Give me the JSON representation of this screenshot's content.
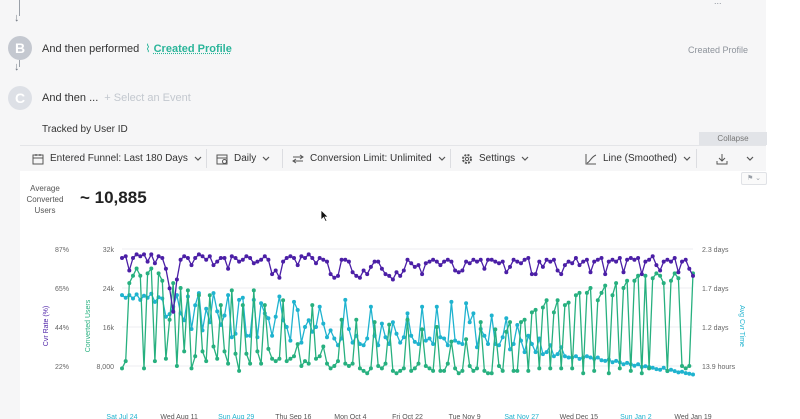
{
  "funnel": {
    "steps": [
      {
        "letter": "B",
        "prefix": "And then performed",
        "event": "Created Profile",
        "right_label": "Created Profile"
      },
      {
        "letter": "C",
        "prefix": "And then ...",
        "add_event": "Select an Event"
      }
    ],
    "tracked_by": "Tracked by User ID",
    "collapse_label": "Collapse",
    "top_right_partial": "..."
  },
  "toolbar": {
    "entered_funnel": "Entered Funnel: Last 180 Days",
    "interval": "Daily",
    "conversion_limit": "Conversion Limit: Unlimited",
    "settings": "Settings",
    "chart_type": "Line (Smoothed)"
  },
  "summary": {
    "label": "Average Converted Users",
    "value": "~ 10,885"
  },
  "chart_data": {
    "type": "line",
    "left_axis_label": "Cvr Rate (%)",
    "middle_axis_label": "Converted Users",
    "right_axis_label": "Avg Cvr Time",
    "left_ticks": [
      "87%",
      "65%",
      "44%",
      "22%"
    ],
    "middle_ticks": [
      "32k",
      "24k",
      "16k",
      "8,000"
    ],
    "right_ticks": [
      "2.3 days",
      "1.7 days",
      "1.2 days",
      "13.9 hours"
    ],
    "x_ticks": [
      {
        "label": "Sat Jul 24",
        "highlight": true
      },
      {
        "label": "Wed Aug 11",
        "highlight": false
      },
      {
        "label": "Sun Aug 29",
        "highlight": true
      },
      {
        "label": "Thu Sep 16",
        "highlight": false
      },
      {
        "label": "Mon Oct 4",
        "highlight": false
      },
      {
        "label": "Fri Oct 22",
        "highlight": false
      },
      {
        "label": "Tue Nov 9",
        "highlight": false
      },
      {
        "label": "Sat Nov 27",
        "highlight": true
      },
      {
        "label": "Wed Dec 15",
        "highlight": false
      },
      {
        "label": "Sun Jan 2",
        "highlight": true
      },
      {
        "label": "Wed Jan 19",
        "highlight": false
      }
    ],
    "conversion_rate_pct": [
      82,
      83,
      75,
      82,
      84,
      83,
      84,
      80,
      84,
      79,
      83,
      82,
      76,
      65,
      52,
      70,
      81,
      83,
      82,
      78,
      82,
      84,
      83,
      81,
      83,
      78,
      80,
      82,
      82,
      76,
      83,
      82,
      80,
      81,
      83,
      82,
      79,
      80,
      81,
      83,
      81,
      73,
      75,
      71,
      80,
      82,
      83,
      82,
      78,
      83,
      82,
      84,
      82,
      79,
      82,
      81,
      80,
      73,
      71,
      72,
      81,
      81,
      80,
      74,
      72,
      71,
      75,
      73,
      77,
      80,
      80,
      76,
      73,
      72,
      70,
      74,
      72,
      75,
      81,
      79,
      77,
      78,
      73,
      79,
      80,
      81,
      80,
      78,
      80,
      81,
      80,
      75,
      74,
      75,
      80,
      79,
      81,
      80,
      81,
      76,
      81,
      81,
      80,
      79,
      80,
      74,
      77,
      81,
      80,
      79,
      81,
      82,
      73,
      73,
      80,
      77,
      81,
      80,
      81,
      75,
      73,
      78,
      80,
      79,
      82,
      78,
      80,
      81,
      74,
      80,
      81,
      82,
      73,
      80,
      81,
      80,
      82,
      74,
      81,
      82,
      81,
      82,
      73,
      80,
      81,
      83,
      78,
      75,
      80,
      81,
      80,
      82,
      74,
      80,
      81,
      76,
      72
    ],
    "converted_users": [
      7500,
      9000,
      25000,
      26500,
      28000,
      26500,
      7500,
      27000,
      28000,
      9000,
      27000,
      25500,
      9500,
      17500,
      25000,
      8000,
      24000,
      11000,
      23500,
      7500,
      10000,
      22500,
      11000,
      9000,
      22500,
      12000,
      9500,
      20500,
      11000,
      8500,
      23500,
      10500,
      7000,
      20500,
      10500,
      8500,
      23500,
      11000,
      8500,
      20500,
      11500,
      9500,
      9000,
      9500,
      21500,
      9000,
      9500,
      10000,
      12500,
      8000,
      9000,
      8500,
      20500,
      9500,
      10000,
      12000,
      8500,
      7500,
      8000,
      9000,
      17500,
      8500,
      8000,
      8500,
      17500,
      7500,
      7000,
      6500,
      7500,
      17000,
      8000,
      7500,
      8500,
      16500,
      7000,
      6500,
      7000,
      7500,
      17500,
      7000,
      7500,
      8500,
      15500,
      8000,
      7500,
      7000,
      16000,
      7000,
      7000,
      8500,
      13000,
      7500,
      6500,
      7000,
      13500,
      8000,
      7000,
      7500,
      17000,
      7000,
      6500,
      6500,
      15500,
      8000,
      7000,
      15000,
      17000,
      7000,
      7000,
      17000,
      17500,
      7000,
      19000,
      19500,
      7500,
      20000,
      21500,
      7500,
      19000,
      21500,
      7500,
      20500,
      21000,
      7500,
      22500,
      23000,
      6500,
      23000,
      24000,
      7000,
      21500,
      23000,
      24500,
      6500,
      22500,
      25000,
      7500,
      24000,
      25500,
      7000,
      25500,
      26500,
      6500,
      26500,
      7500,
      26000,
      27000,
      26500,
      25000,
      7000,
      25500,
      27000,
      26000,
      8000,
      7500,
      8000,
      27000
    ],
    "avg_cvr_time_days": [
      1.62,
      1.58,
      1.62,
      1.57,
      1.63,
      1.55,
      1.61,
      1.58,
      1.64,
      1.52,
      1.59,
      1.57,
      1.3,
      1.34,
      1.45,
      1.62,
      1.35,
      1.25,
      1.6,
      1.12,
      1.47,
      1.65,
      1.1,
      1.42,
      1.22,
      1.65,
      1.38,
      1.18,
      1.32,
      1.62,
      1.0,
      1.05,
      1.55,
      1.58,
      1.02,
      1.02,
      1.55,
      1.0,
      1.5,
      1.35,
      1.28,
      1.02,
      1.3,
      1.6,
      1.25,
      1.15,
      0.95,
      1.52,
      1.4,
      0.92,
      1.15,
      1.25,
      1.08,
      1.15,
      1.45,
      1.2,
      1.0,
      1.1,
      0.98,
      0.88,
      0.98,
      1.55,
      1.12,
      0.92,
      1.02,
      0.9,
      0.88,
      0.98,
      1.45,
      1.02,
      0.88,
      1.2,
      1.0,
      0.9,
      1.22,
      1.05,
      0.92,
      1.0,
      1.35,
      1.02,
      0.93,
      0.9,
      1.45,
      0.95,
      0.98,
      0.9,
      1.45,
      1.0,
      0.98,
      0.88,
      1.52,
      0.95,
      0.92,
      0.9,
      1.5,
      1.22,
      1.35,
      0.85,
      1.12,
      1.02,
      0.9,
      1.32,
      0.9,
      0.88,
      1.0,
      1.28,
      0.82,
      0.9,
      1.18,
      0.95,
      0.78,
      1.02,
      0.9,
      0.78,
      0.98,
      0.75,
      0.78,
      0.88,
      0.72,
      0.75,
      0.85,
      0.72,
      0.7,
      0.7,
      0.72,
      0.68,
      0.7,
      0.72,
      0.7,
      0.68,
      0.7,
      0.66,
      0.65,
      0.67,
      0.63,
      0.65,
      0.63,
      0.6,
      0.62,
      0.6,
      0.58,
      0.6,
      0.56,
      0.57,
      0.56,
      0.55,
      0.53,
      0.52,
      0.55,
      0.5,
      0.52,
      0.5,
      0.48,
      0.49,
      0.47,
      0.46,
      0.45
    ],
    "left_range": [
      0,
      87
    ],
    "middle_range": [
      0,
      32000
    ],
    "right_range_days": [
      0,
      2.3
    ],
    "grid": true,
    "series_colors": {
      "conversion_rate": "#4b1fa6",
      "converted_users": "#27b07f",
      "avg_cvr_time": "#1fb3cf"
    }
  }
}
